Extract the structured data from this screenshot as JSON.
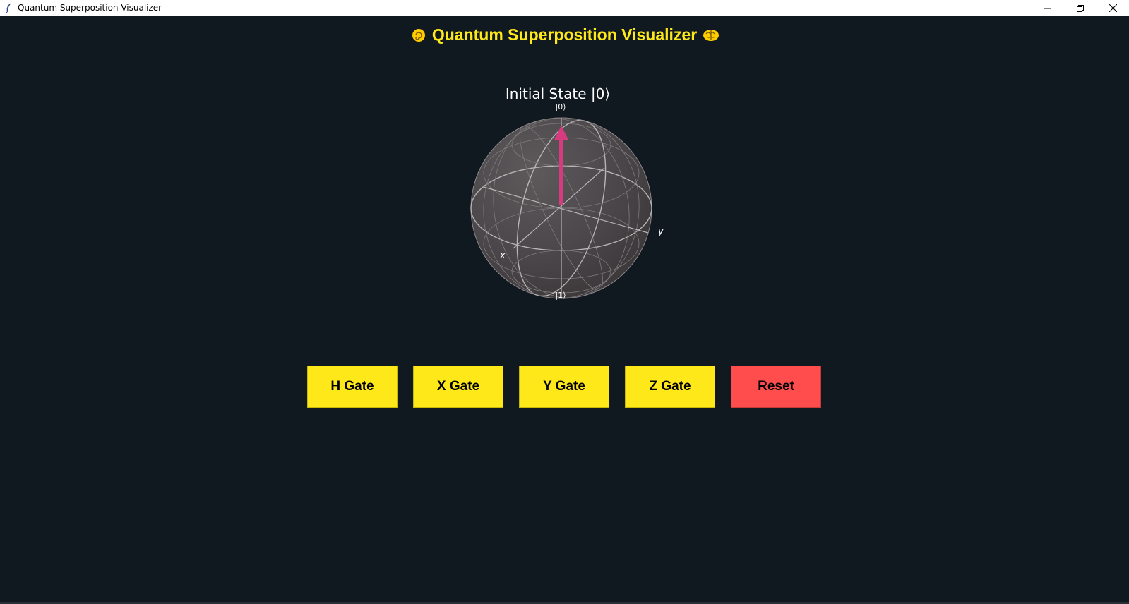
{
  "window": {
    "title": "Quantum Superposition Visualizer",
    "icon": "feather-icon",
    "controls": [
      "minimize-icon",
      "restore-icon",
      "close-icon"
    ]
  },
  "header": {
    "title": "Quantum Superposition Visualizer",
    "left_icon": "swirl-emoji",
    "right_icon": "brain-emoji",
    "color": "#ffe81a"
  },
  "bloch_sphere": {
    "title": "Initial State |0⟩",
    "top_label": "|0⟩",
    "bottom_label": "|1⟩",
    "x_label": "x",
    "y_label": "y",
    "state_vector_color": "#d63a7f",
    "state": "|0⟩"
  },
  "buttons": {
    "h": "H Gate",
    "x": "X Gate",
    "y": "Y Gate",
    "z": "Z Gate",
    "reset": "Reset",
    "gate_color": "#ffe81a",
    "reset_color": "#ff4d4d"
  },
  "colors": {
    "background": "#101820"
  }
}
